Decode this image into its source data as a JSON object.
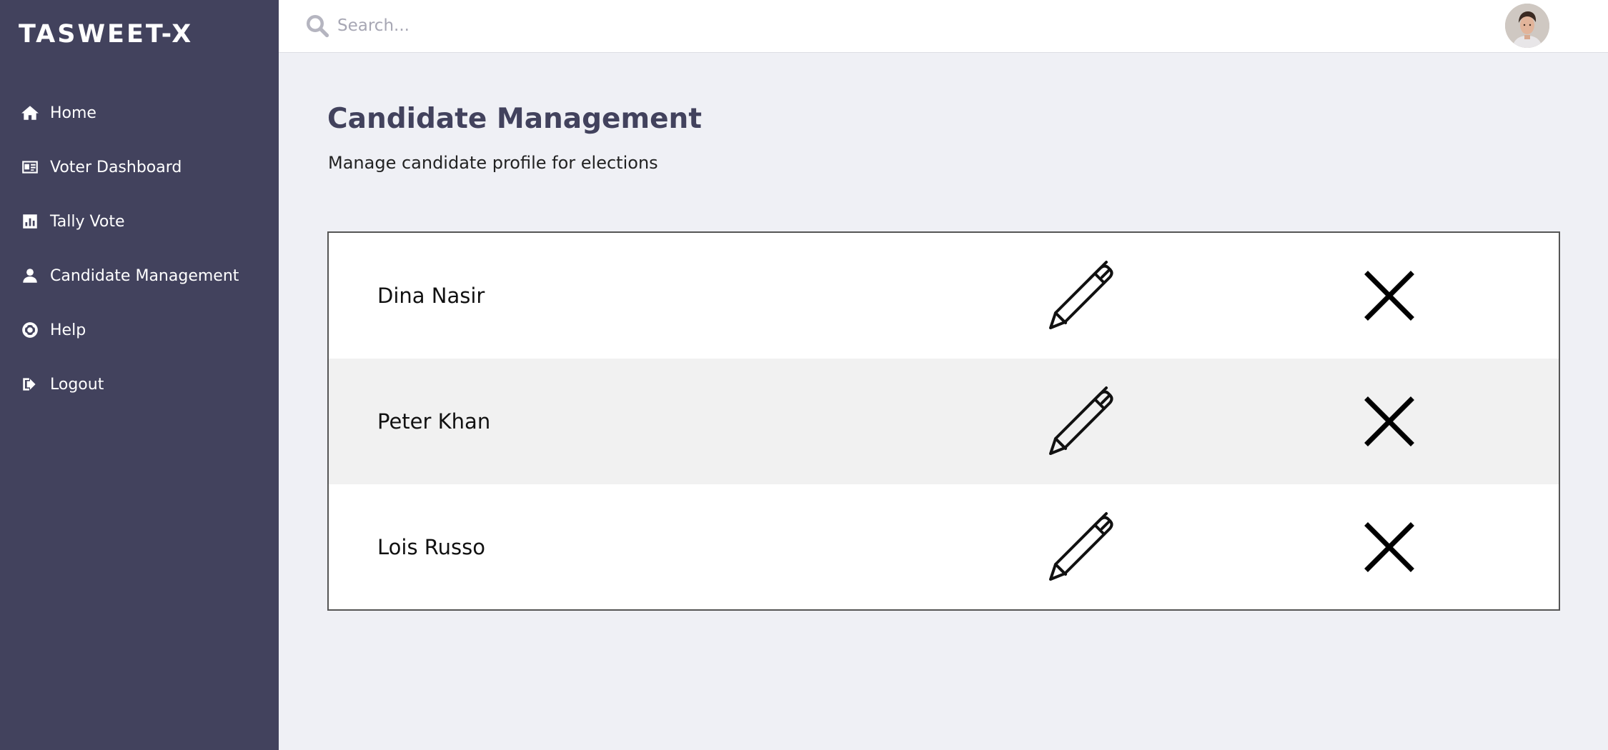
{
  "app": {
    "brand": "TASWEET-X"
  },
  "sidebar": {
    "items": [
      {
        "label": "Home",
        "icon": "home-icon"
      },
      {
        "label": "Voter Dashboard",
        "icon": "id-card-icon"
      },
      {
        "label": "Tally Vote",
        "icon": "chart-icon"
      },
      {
        "label": "Candidate Management",
        "icon": "user-icon"
      },
      {
        "label": "Help",
        "icon": "life-ring-icon"
      },
      {
        "label": "Logout",
        "icon": "sign-out-icon"
      }
    ]
  },
  "search": {
    "placeholder": "Search..."
  },
  "page": {
    "title": "Candidate Management",
    "subtitle": "Manage candidate profile for elections"
  },
  "candidates": [
    {
      "name": "Dina Nasir"
    },
    {
      "name": "Peter Khan"
    },
    {
      "name": "Lois Russo"
    }
  ],
  "colors": {
    "sidebar_bg": "#42425d",
    "page_bg": "#eff0f5",
    "title": "#42425d"
  }
}
